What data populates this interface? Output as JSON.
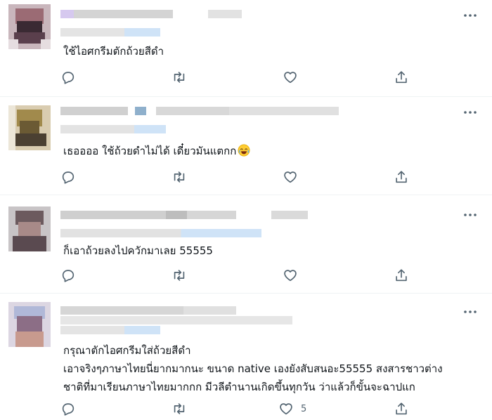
{
  "tweets": [
    {
      "text_lines": [
        "ใช้ไอศกรีมตักถ้วยสีดำ"
      ],
      "like_count": "",
      "icons": {
        "reply": "reply-icon",
        "retweet": "retweet-icon",
        "like": "heart-icon",
        "share": "share-icon",
        "more": "more-dots-icon"
      }
    },
    {
      "text_lines": [
        "เธออออ ใช้ถ้วยดำไม่ได้ เดี๋ยวมันแตกก"
      ],
      "emoji": "face-with-tears-of-joy",
      "like_count": "",
      "icons": {
        "reply": "reply-icon",
        "retweet": "retweet-icon",
        "like": "heart-icon",
        "share": "share-icon",
        "more": "more-dots-icon"
      }
    },
    {
      "text_lines": [
        "ก็เอาถ้วยลงไปควักมาเลย 55555"
      ],
      "like_count": "",
      "icons": {
        "reply": "reply-icon",
        "retweet": "retweet-icon",
        "like": "heart-icon",
        "share": "share-icon",
        "more": "more-dots-icon"
      }
    },
    {
      "text_lines": [
        "กรุณาตักไอศกรีมใส่ถ้วยสีดำ",
        "เอาจริงๆภาษาไทยนี่ยากมากนะ ขนาด native เองยังสับสนอะ55555 สงสารชาวต่าง",
        "ชาติที่มาเรียนภาษาไทยมากกก มีวลีตำนานเกิดขึ้นทุกวัน ว่าแล้วก็ขั้นจะฉาปแก"
      ],
      "like_count": "5",
      "icons": {
        "reply": "reply-icon",
        "retweet": "retweet-icon",
        "like": "heart-icon",
        "share": "share-icon",
        "more": "more-dots-icon"
      }
    }
  ],
  "colors": {
    "icon": "#536471",
    "text": "#0f1419",
    "divider": "#eff3f4",
    "blur_gray": "#d9d9d9",
    "blur_blue": "#cfe3f7"
  }
}
